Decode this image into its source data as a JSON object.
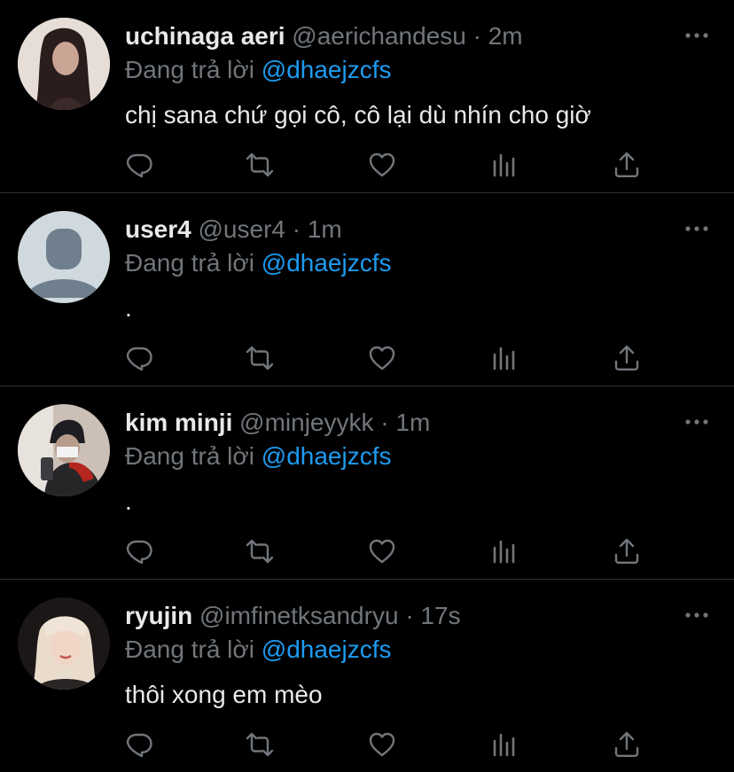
{
  "colors": {
    "background": "#000000",
    "primary_text": "#e7e9ea",
    "secondary_text": "#71767b",
    "accent": "#1d9bf0",
    "divider": "#2f3336"
  },
  "icons": {
    "reply": "reply-icon",
    "retweet": "retweet-icon",
    "like": "heart-icon",
    "stats": "stats-icon",
    "share": "share-icon",
    "more": "more-icon"
  },
  "tweets": [
    {
      "name": "uchinaga aeri",
      "handle": "@aerichandesu",
      "dot": "·",
      "time": "2m",
      "replying_prefix": "Đang trả lời",
      "replying_to": "@dhaejzcfs",
      "text": "chị sana chứ gọi cô, cô lại dù nhín cho giờ"
    },
    {
      "name": "user4",
      "handle": "@user4",
      "dot": "·",
      "time": "1m",
      "replying_prefix": "Đang trả lời",
      "replying_to": "@dhaejzcfs",
      "text": "."
    },
    {
      "name": "kim minji",
      "handle": "@minjeyykk",
      "dot": "·",
      "time": "1m",
      "replying_prefix": "Đang trả lời",
      "replying_to": "@dhaejzcfs",
      "text": "."
    },
    {
      "name": "ryujin",
      "handle": "@imfinetksandryu",
      "dot": "·",
      "time": "17s",
      "replying_prefix": "Đang trả lời",
      "replying_to": "@dhaejzcfs",
      "text": "thôi xong em mèo"
    }
  ]
}
